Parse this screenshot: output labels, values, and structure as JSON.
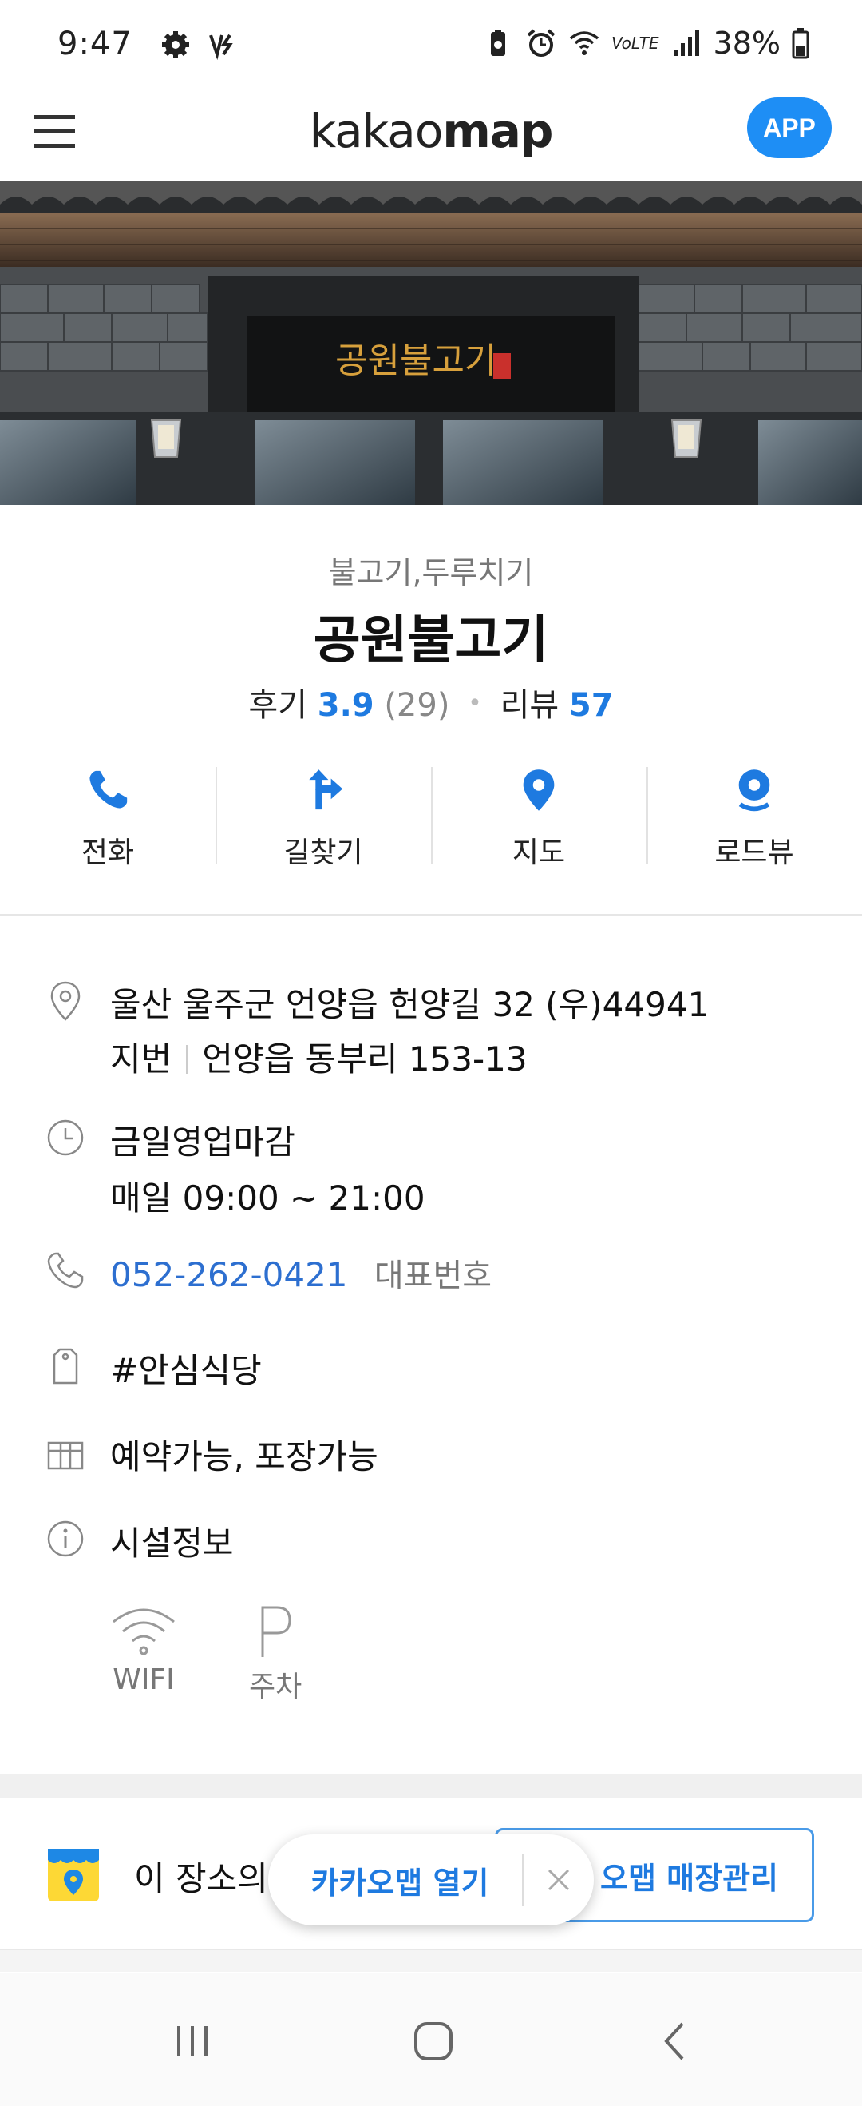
{
  "status_bar": {
    "time": "9:47",
    "battery": "38%",
    "network": "VoLTE"
  },
  "header": {
    "logo_light": "kakao",
    "logo_bold": "map",
    "app_button": "APP"
  },
  "hero": {
    "sign_text": "공원불고기"
  },
  "place": {
    "category": "불고기,두루치기",
    "name": "공원불고기",
    "review_label": "후기",
    "review_score": "3.9",
    "review_count": "(29)",
    "blog_label": "리뷰",
    "blog_count": "57"
  },
  "actions": [
    {
      "label": "전화",
      "icon": "phone-icon"
    },
    {
      "label": "길찾기",
      "icon": "directions-icon"
    },
    {
      "label": "지도",
      "icon": "map-pin-icon"
    },
    {
      "label": "로드뷰",
      "icon": "roadview-icon"
    }
  ],
  "details": {
    "address": "울산 울주군 언양읍 헌양길 32 (우)44941",
    "lot_label": "지번",
    "lot_address": "언양읍 동부리 153-13",
    "hours_status": "금일영업마감",
    "hours": "매일 09:00 ~ 21:00",
    "phone": "052-262-0421",
    "phone_label": "대표번호",
    "tag": "#안심식당",
    "services": "예약가능, 포장가능",
    "facility_title": "시설정보",
    "facilities": [
      {
        "label": "WIFI",
        "icon": "wifi-icon"
      },
      {
        "label": "주차",
        "icon": "parking-icon"
      }
    ]
  },
  "owner_banner": {
    "text": "이 장소의",
    "button": "오맵 매장관리"
  },
  "floating_pill": {
    "open_label": "카카오맵 열기"
  },
  "colors": {
    "accent_blue": "#1e7ae0",
    "closed_red": "#e8474a",
    "app_button": "#1e8ef5"
  }
}
